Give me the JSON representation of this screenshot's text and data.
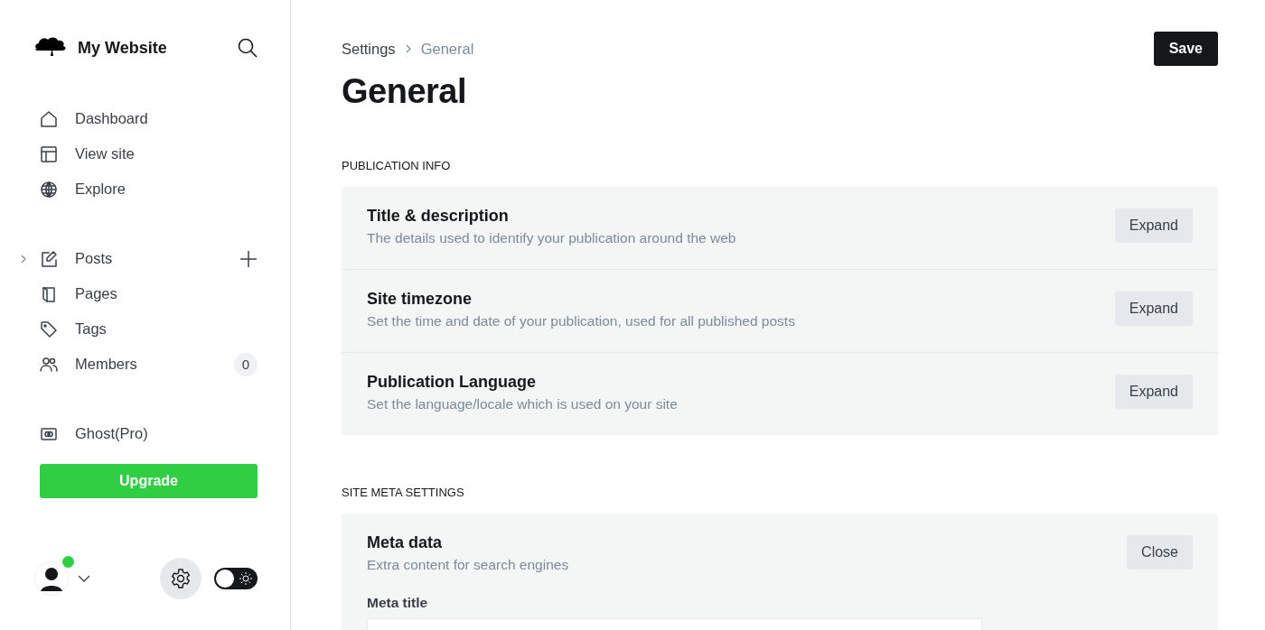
{
  "site": {
    "name": "My Website"
  },
  "nav_groups": [
    {
      "items": [
        {
          "label": "Dashboard"
        },
        {
          "label": "View site"
        },
        {
          "label": "Explore"
        }
      ]
    },
    {
      "items": [
        {
          "label": "Posts",
          "expanded": false,
          "add": true
        },
        {
          "label": "Pages"
        },
        {
          "label": "Tags"
        },
        {
          "label": "Members",
          "count": "0"
        }
      ]
    },
    {
      "items": [
        {
          "label": "Ghost(Pro)"
        }
      ]
    }
  ],
  "upgrade_button": "Upgrade",
  "user": {
    "online": true
  },
  "theme_toggle": {
    "on": false
  },
  "breadcrumb": [
    "Settings",
    "General"
  ],
  "save_button": "Save",
  "page_title": "General",
  "sections": [
    {
      "heading": "PUBLICATION INFO",
      "items": [
        {
          "title": "Title & description",
          "description": "The details used to identify your publication around the web",
          "button": "Expand"
        },
        {
          "title": "Site timezone",
          "description": "Set the time and date of your publication, used for all published posts",
          "button": "Expand"
        },
        {
          "title": "Publication Language",
          "description": "Set the language/locale which is used on your site",
          "button": "Expand"
        }
      ]
    },
    {
      "heading": "SITE META SETTINGS",
      "items": [
        {
          "title": "Meta data",
          "description": "Extra content for search engines",
          "button": "Close",
          "fields": [
            {
              "label": "Meta title"
            }
          ]
        }
      ]
    }
  ]
}
